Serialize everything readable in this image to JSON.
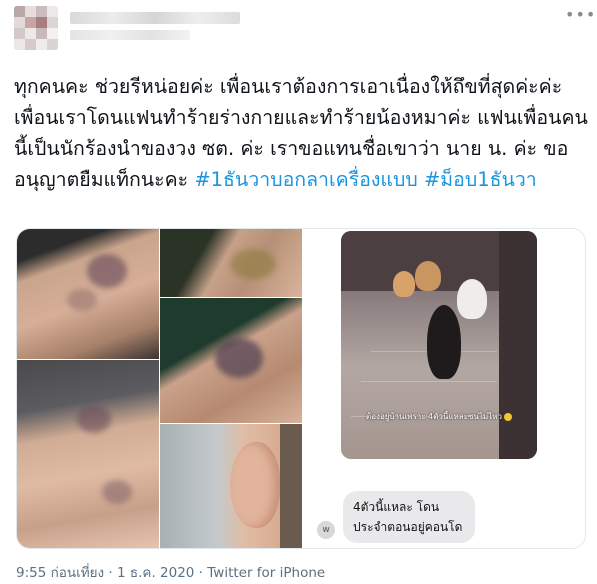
{
  "tweet": {
    "more_icon": "more-dots-icon",
    "text_main": "ทุกคนคะ ช่วยรีหน่อยค่ะ เพื่อนเราต้องการเอาเนื่องให้ถึขที่สุดค่ะค่ะ เพื่อนเราโดนแฟนทำร้ายร่างกายและทำร้ายน้องหมาค่ะ แฟนเพื่อนคนนี้เป็นนักร้องนำของวง ซต. ค่ะ เราขอแทนชื่อเขาว่า นาย น. ค่ะ ขออนุญาตยืมแท็กนะคะ ",
    "hashtag_1": "#1ธันวาบอกลาเครื่องแบบ",
    "hashtag_2": "#ม็อบ1ธันวา",
    "chat": {
      "photo_caption": "ต้องอยู่บ้านเพราะ 4ตัวนี้แหละซนไม่ไหว",
      "avatar_letter": "w",
      "bubble_text": "4ตัวนี้แหละ โดนประจำตอนอยู่คอนโด"
    },
    "meta": "9:55 ก่อนเที่ยง · 1 ธ.ค. 2020 · Twitter for iPhone"
  }
}
